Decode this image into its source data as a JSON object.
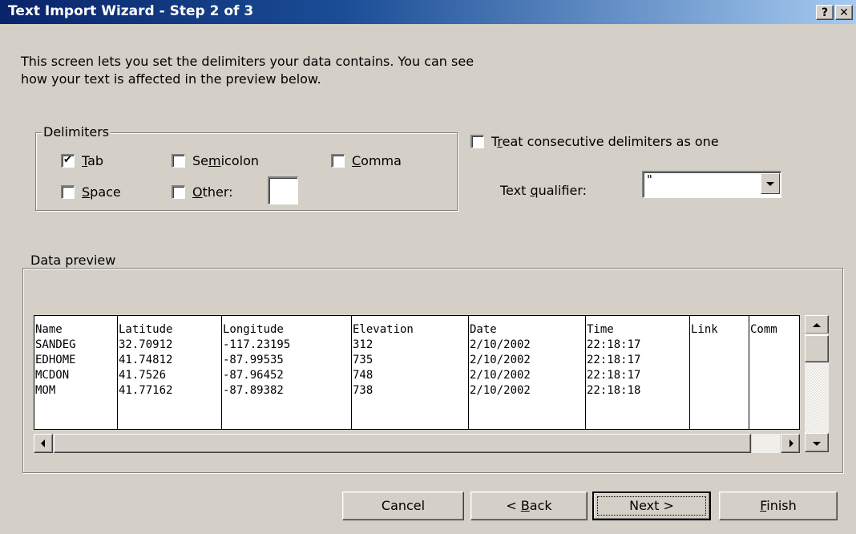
{
  "window": {
    "title": "Text Import Wizard - Step 2 of 3",
    "help_label": "?",
    "close_label": "✕"
  },
  "intro": {
    "line1": "This screen lets you set the delimiters your data contains.  You can see",
    "line2": "how your text is affected in the preview below."
  },
  "delimiters": {
    "legend": "Delimiters",
    "tab": {
      "pre": "",
      "key": "T",
      "post": "ab",
      "checked": true
    },
    "semicolon": {
      "pre": "Se",
      "key": "m",
      "post": "icolon",
      "checked": false
    },
    "comma": {
      "pre": "",
      "key": "C",
      "post": "omma",
      "checked": false
    },
    "space": {
      "pre": "",
      "key": "S",
      "post": "pace",
      "checked": false
    },
    "other": {
      "pre": "",
      "key": "O",
      "post": "ther:",
      "checked": false,
      "value": ""
    },
    "check_glyph": "✔"
  },
  "options": {
    "consecutive": {
      "pre": "T",
      "key": "r",
      "post": "eat consecutive delimiters as one",
      "checked": false
    },
    "qualifier": {
      "pre": "Text ",
      "key": "q",
      "post": "ualifier:",
      "value": "\""
    }
  },
  "preview": {
    "legend": "Data preview",
    "columns": [
      {
        "header": "Name",
        "cells": [
          "SANDEG",
          "EDHOME",
          "MCDON",
          "MOM"
        ]
      },
      {
        "header": "Latitude",
        "cells": [
          "32.70912",
          "41.74812",
          "41.7526",
          "41.77162"
        ]
      },
      {
        "header": "Longitude",
        "cells": [
          "-117.23195",
          "-87.99535",
          "-87.96452",
          "-87.89382"
        ]
      },
      {
        "header": "Elevation",
        "cells": [
          "312",
          "735",
          "748",
          "738"
        ]
      },
      {
        "header": "Date",
        "cells": [
          "2/10/2002",
          "2/10/2002",
          "2/10/2002",
          "2/10/2002"
        ]
      },
      {
        "header": "Time",
        "cells": [
          "22:18:17",
          "22:18:17",
          "22:18:17",
          "22:18:18"
        ]
      },
      {
        "header": "Link",
        "cells": [
          "",
          "",
          "",
          ""
        ]
      },
      {
        "header": "Comm",
        "cells": [
          "",
          "",
          "",
          ""
        ]
      }
    ]
  },
  "buttons": {
    "cancel": {
      "pre": "Cancel",
      "key": "",
      "post": ""
    },
    "back": {
      "pre": "< ",
      "key": "B",
      "post": "ack"
    },
    "next": {
      "pre": "Next >",
      "key": "",
      "post": ""
    },
    "finish": {
      "pre": "",
      "key": "F",
      "post": "inish"
    }
  }
}
